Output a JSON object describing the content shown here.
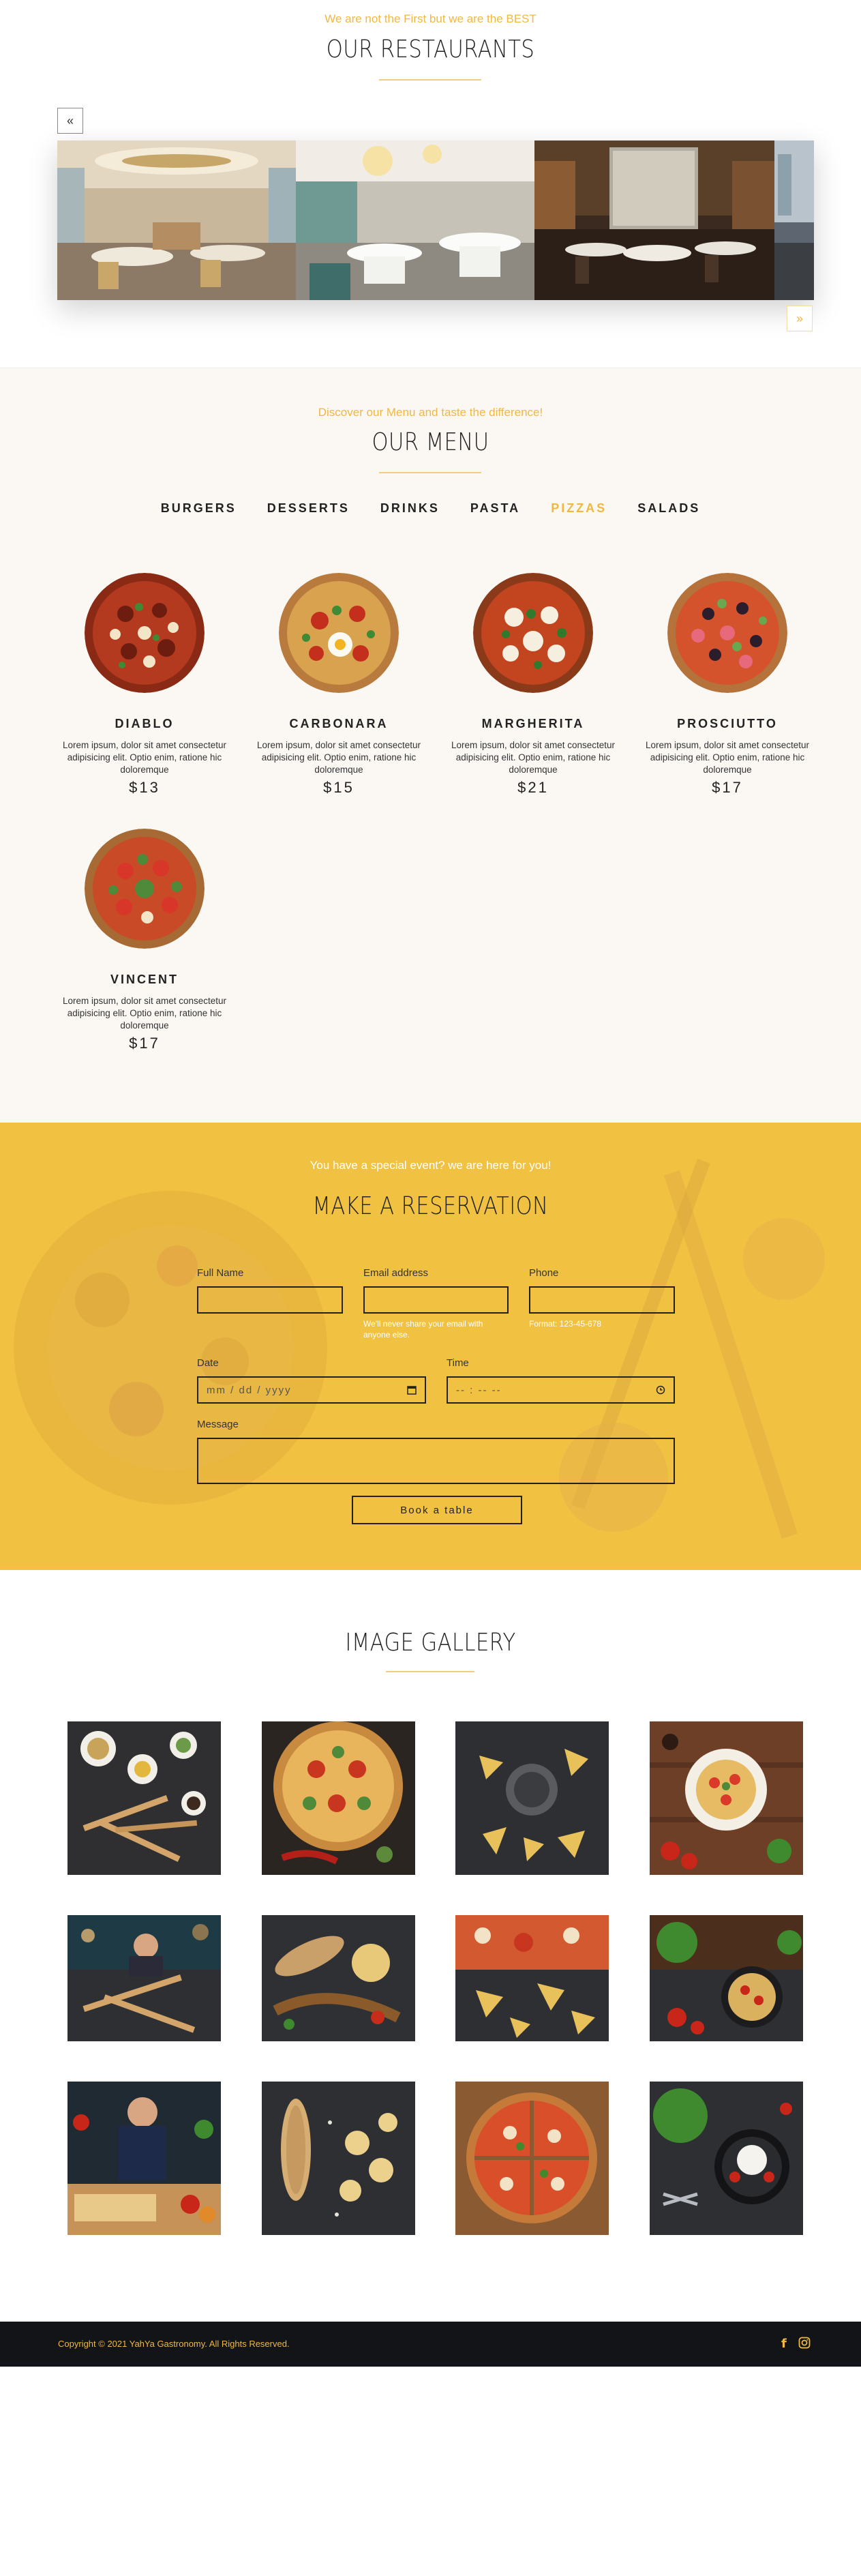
{
  "restaurants": {
    "tagline": "We are not the First but we are the BEST",
    "title": "OUR RESTAURANTS",
    "prev_label": "«",
    "next_label": "»"
  },
  "menu": {
    "tagline": "Discover our Menu and taste the difference!",
    "title": "OUR MENU",
    "tabs": [
      "BURGERS",
      "DESSERTS",
      "DRINKS",
      "PASTA",
      "PIZZAS",
      "SALADS"
    ],
    "active_tab": "PIZZAS",
    "items": [
      {
        "name": "DIABLO",
        "desc": "Lorem ipsum, dolor sit amet consectetur adipisicing elit. Optio enim, ratione hic doloremque",
        "price": "$13"
      },
      {
        "name": "CARBONARA",
        "desc": "Lorem ipsum, dolor sit amet consectetur adipisicing elit. Optio enim, ratione hic doloremque",
        "price": "$15"
      },
      {
        "name": "MARGHERITA",
        "desc": "Lorem ipsum, dolor sit amet consectetur adipisicing elit. Optio enim, ratione hic doloremque",
        "price": "$21"
      },
      {
        "name": "PROSCIUTTO",
        "desc": "Lorem ipsum, dolor sit amet consectetur adipisicing elit. Optio enim, ratione hic doloremque",
        "price": "$17"
      },
      {
        "name": "VINCENT",
        "desc": "Lorem ipsum, dolor sit amet consectetur adipisicing elit. Optio enim, ratione hic doloremque",
        "price": "$17"
      }
    ]
  },
  "reservation": {
    "tagline": "You have a special event? we are here for you!",
    "title": "MAKE A RESERVATION",
    "full_name_label": "Full Name",
    "email_label": "Email address",
    "email_hint": "We'll never share your email with anyone else.",
    "phone_label": "Phone",
    "phone_hint": "Format: 123-45-678",
    "date_label": "Date",
    "date_placeholder": "mm / dd / yyyy",
    "time_label": "Time",
    "time_placeholder": "-- : -- --",
    "message_label": "Message",
    "book_label": "Book a table"
  },
  "gallery": {
    "title": "IMAGE GALLERY"
  },
  "footer": {
    "copyright": "Copyright © 2021 YahYa Gastronomy. All Rights Reserved.",
    "facebook_icon": "f",
    "instagram_icon": "◎"
  },
  "colors": {
    "accent": "#f0b840",
    "reservation_bg": "#f1c142",
    "menu_bg": "#fbf8f4",
    "footer_bg": "#121418"
  }
}
